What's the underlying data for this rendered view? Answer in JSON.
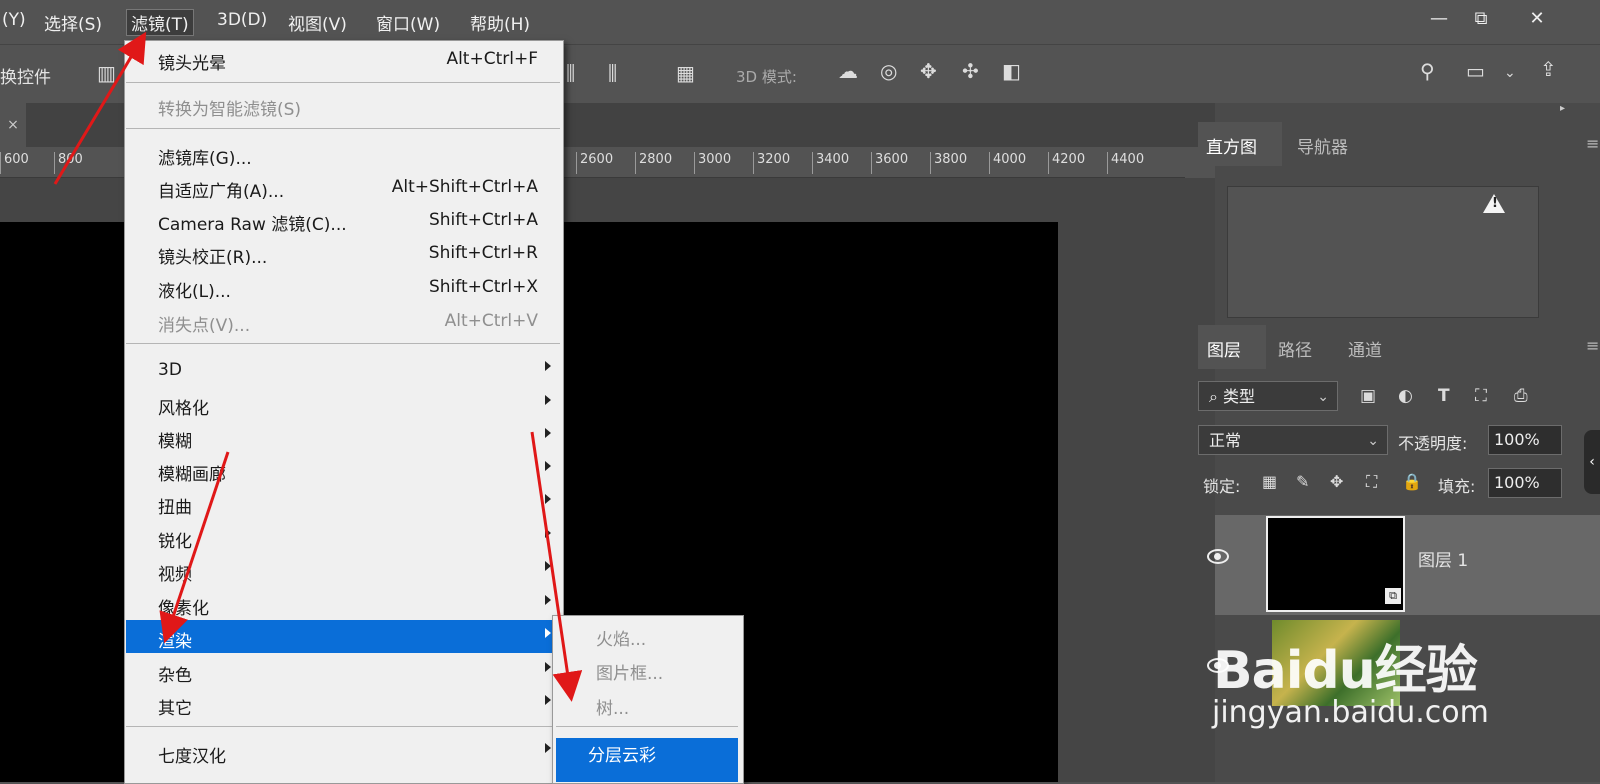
{
  "menubar": {
    "items": [
      "(Y)",
      "选择(S)",
      "滤镜(T)",
      "3D(D)",
      "视图(V)",
      "窗口(W)",
      "帮助(H)"
    ],
    "window_controls": [
      "—",
      "⧉",
      "✕"
    ]
  },
  "options_bar": {
    "left_label": "换控件",
    "mode_label": "3D 模式:"
  },
  "document": {
    "tab_close": "×",
    "ruler_ticks": [
      "600",
      "800",
      "2600",
      "2800",
      "3000",
      "3200",
      "3400",
      "3600",
      "3800",
      "4000",
      "4200",
      "4400"
    ]
  },
  "filter_menu": {
    "items": [
      {
        "label": "镜头光晕",
        "shortcut": "Alt+Ctrl+F",
        "disabled": false
      },
      {
        "label": "转换为智能滤镜(S)",
        "shortcut": "",
        "disabled": true
      },
      {
        "label": "滤镜库(G)...",
        "shortcut": "",
        "disabled": false
      },
      {
        "label": "自适应广角(A)...",
        "shortcut": "Alt+Shift+Ctrl+A",
        "disabled": false
      },
      {
        "label": "Camera Raw 滤镜(C)...",
        "shortcut": "Shift+Ctrl+A",
        "disabled": false
      },
      {
        "label": "镜头校正(R)...",
        "shortcut": "Shift+Ctrl+R",
        "disabled": false
      },
      {
        "label": "液化(L)...",
        "shortcut": "Shift+Ctrl+X",
        "disabled": false
      },
      {
        "label": "消失点(V)...",
        "shortcut": "Alt+Ctrl+V",
        "disabled": true
      },
      {
        "label": "3D",
        "submenu": true
      },
      {
        "label": "风格化",
        "submenu": true
      },
      {
        "label": "模糊",
        "submenu": true
      },
      {
        "label": "模糊画廊",
        "submenu": true
      },
      {
        "label": "扭曲",
        "submenu": true
      },
      {
        "label": "锐化",
        "submenu": true
      },
      {
        "label": "视频",
        "submenu": true
      },
      {
        "label": "像素化",
        "submenu": true
      },
      {
        "label": "渲染",
        "submenu": true,
        "highlighted": true
      },
      {
        "label": "杂色",
        "submenu": true
      },
      {
        "label": "其它",
        "submenu": true
      },
      {
        "label": "七度汉化",
        "submenu": true
      }
    ]
  },
  "render_submenu": {
    "items": [
      "火焰...",
      "图片框...",
      "树...",
      "分层云彩"
    ],
    "highlighted": "分层云彩"
  },
  "panels": {
    "top_tabs": [
      "直方图",
      "导航器"
    ],
    "histogram_warning": "!",
    "layer_tabs": [
      "图层",
      "路径",
      "通道"
    ],
    "filter_kind": "类型",
    "blend_mode": "正常",
    "opacity_label": "不透明度:",
    "opacity_value": "100%",
    "lock_label": "锁定:",
    "fill_label": "填充:",
    "fill_value": "100%",
    "layers": [
      {
        "name": "图层 1"
      }
    ]
  },
  "watermark": {
    "logo": "Baidu经验",
    "url": "jingyan.baidu.com"
  },
  "colors": {
    "highlight": "#0a6ed8",
    "menu_bg": "#f0f0f0",
    "ui_bg": "#535353",
    "arrow": "#e01818"
  }
}
